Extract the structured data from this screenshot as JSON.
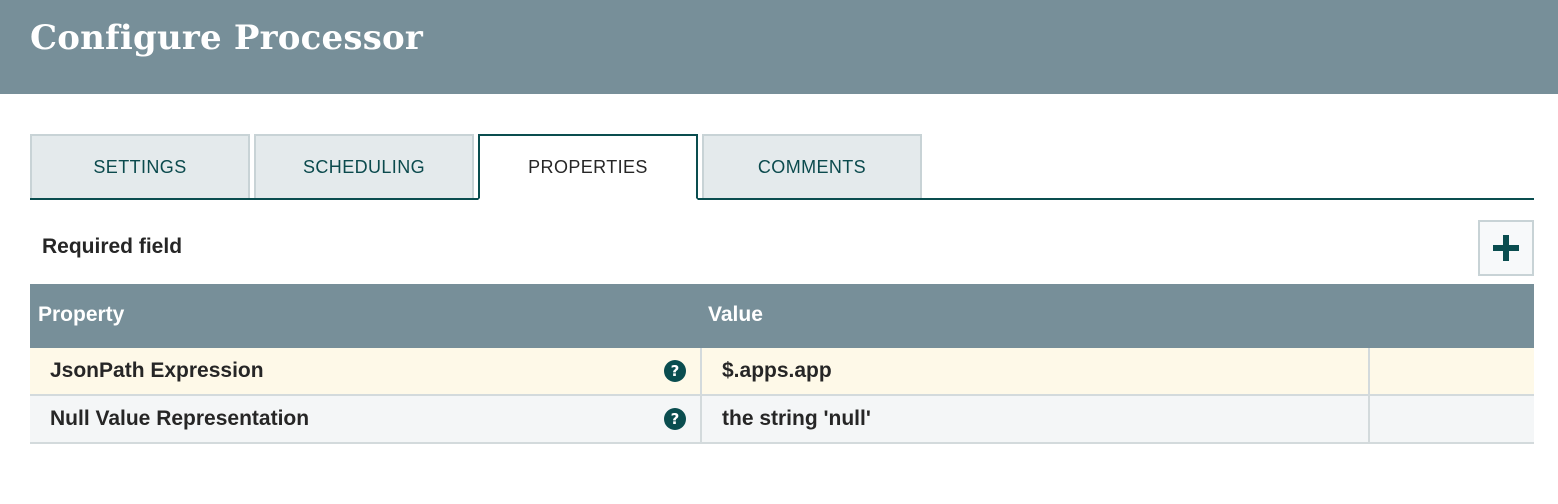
{
  "header": {
    "title": "Configure Processor"
  },
  "tabs": [
    {
      "label": "SETTINGS"
    },
    {
      "label": "SCHEDULING"
    },
    {
      "label": "PROPERTIES"
    },
    {
      "label": "COMMENTS"
    }
  ],
  "active_tab": "PROPERTIES",
  "properties": {
    "required_label": "Required field",
    "columns": {
      "property": "Property",
      "value": "Value"
    },
    "rows": [
      {
        "name": "JsonPath Expression",
        "value": "$.apps.app",
        "help_icon": "question-circle-icon"
      },
      {
        "name": "Null Value Representation",
        "value": "the string 'null'",
        "help_icon": "question-circle-icon"
      }
    ],
    "add_icon": "plus-icon"
  },
  "colors": {
    "header_bg": "#778f99",
    "accent": "#0a4d4f",
    "highlight_row": "#fef9e8"
  }
}
